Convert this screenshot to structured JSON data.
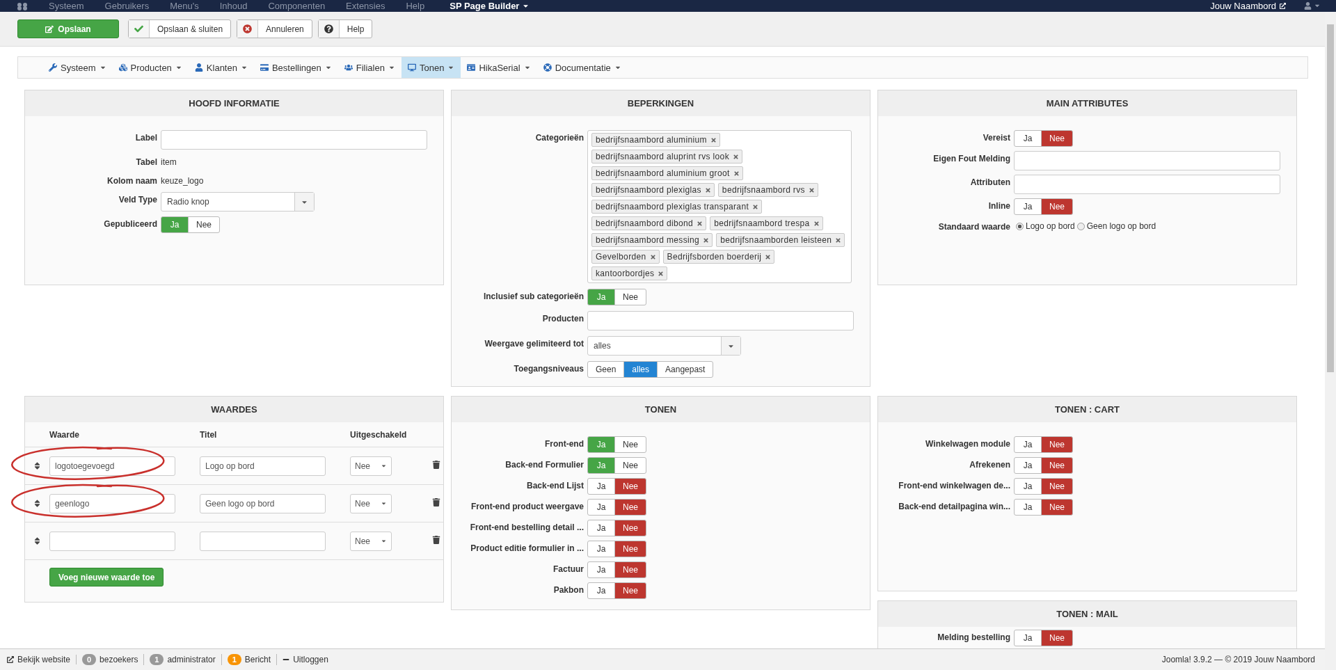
{
  "top_menu": {
    "items": [
      "Systeem",
      "Gebruikers",
      "Menu's",
      "Inhoud",
      "Componenten",
      "Extensies",
      "Help"
    ],
    "app": "SP Page Builder",
    "site": "Jouw Naambord"
  },
  "toolbar": [
    {
      "kind": "primary",
      "label": "Opslaan"
    },
    {
      "kind": "apply",
      "label": "Opslaan & sluiten"
    },
    {
      "kind": "cancel",
      "label": "Annuleren"
    },
    {
      "kind": "help",
      "label": "Help"
    }
  ],
  "nav": [
    {
      "label": "Systeem",
      "selected": false
    },
    {
      "label": "Producten",
      "selected": false
    },
    {
      "label": "Klanten",
      "selected": false
    },
    {
      "label": "Bestellingen",
      "selected": false
    },
    {
      "label": "Filialen",
      "selected": false
    },
    {
      "label": "Tonen",
      "selected": true
    },
    {
      "label": "HikaSerial",
      "selected": false
    },
    {
      "label": "Documentatie",
      "selected": false
    }
  ],
  "panels": [
    {
      "kind": "form",
      "title": "HOOFD INFORMATIE",
      "fields": [
        {
          "kind": "input",
          "label": "Label"
        },
        {
          "kind": "text",
          "label": "Tabel",
          "value": "item"
        },
        {
          "kind": "text",
          "label": "Kolom naam",
          "value": "keuze_logo"
        },
        {
          "kind": "select",
          "label": "Veld Type",
          "value": "Radio knop"
        },
        {
          "kind": "toggle",
          "label": "Gepubliceerd",
          "options": [
            {
              "label": "Ja",
              "selected": true
            },
            {
              "label": "Nee",
              "selected": false
            }
          ]
        }
      ]
    },
    {
      "kind": "form",
      "title": "BEPERKINGEN",
      "fields": [
        {
          "kind": "tags",
          "label": "Categorieën",
          "tags": [
            "bedrijfsnaambord aluminium",
            "bedrijfsnaambord aluprint rvs look",
            "bedrijfsnaambord aluminium groot",
            "bedrijfsnaambord plexiglas",
            "bedrijfsnaambord rvs",
            "bedrijfsnaambord plexiglas transparant",
            "bedrijfsnaambord dibond",
            "bedrijfsnaambord trespa",
            "bedrijfsnaambord messing",
            "bedrijfsnaamborden leisteen",
            "Gevelborden",
            "Bedrijfsborden boerderij",
            "kantoorbordjes"
          ]
        },
        {
          "kind": "toggle",
          "label": "Inclusief sub categorieën",
          "options": [
            {
              "label": "Ja",
              "selected": true
            },
            {
              "label": "Nee",
              "selected": false
            }
          ]
        },
        {
          "kind": "input",
          "label": "Producten"
        },
        {
          "kind": "select",
          "label": "Weergave gelimiteerd tot",
          "value": "alles"
        },
        {
          "kind": "segmented",
          "label": "Toegangsniveaus",
          "options": [
            {
              "label": "Geen",
              "selected": false
            },
            {
              "label": "alles",
              "selected": true
            },
            {
              "label": "Aangepast",
              "selected": false
            }
          ]
        }
      ]
    },
    {
      "kind": "form",
      "title": "MAIN ATTRIBUTES",
      "fields": [
        {
          "kind": "toggle",
          "label": "Vereist",
          "options": [
            {
              "label": "Ja",
              "selected": false
            },
            {
              "label": "Nee",
              "selected": true
            }
          ]
        },
        {
          "kind": "input",
          "label": "Eigen Fout Melding"
        },
        {
          "kind": "input",
          "label": "Attributen"
        },
        {
          "kind": "toggle",
          "label": "Inline",
          "options": [
            {
              "label": "Ja",
              "selected": false
            },
            {
              "label": "Nee",
              "selected": true
            }
          ]
        },
        {
          "kind": "radio",
          "label": "Standaard waarde",
          "options": [
            {
              "label": "Logo op bord",
              "selected": true
            },
            {
              "label": "Geen logo op bord",
              "selected": false
            }
          ]
        }
      ]
    },
    {
      "kind": "values_table",
      "title": "WAARDES",
      "columns": [
        "Waarde",
        "Titel",
        "Uitgeschakeld"
      ],
      "rows": [
        {
          "value": "logotoegevoegd",
          "title": "Logo op bord",
          "disabled": "Nee",
          "circled": true
        },
        {
          "value": "geenlogo",
          "title": "Geen logo op bord",
          "disabled": "Nee",
          "circled": true
        },
        {
          "disabled": "Nee",
          "circled": false
        }
      ],
      "add_button": "Voeg nieuwe waarde toe"
    },
    {
      "kind": "form",
      "title": "TONEN",
      "fields": [
        {
          "kind": "toggle",
          "label": "Front-end",
          "options": [
            {
              "label": "Ja",
              "selected": true
            },
            {
              "label": "Nee",
              "selected": false
            }
          ]
        },
        {
          "kind": "toggle",
          "label": "Back-end Formulier",
          "options": [
            {
              "label": "Ja",
              "selected": true
            },
            {
              "label": "Nee",
              "selected": false
            }
          ]
        },
        {
          "kind": "toggle",
          "label": "Back-end Lijst",
          "options": [
            {
              "label": "Ja",
              "selected": false
            },
            {
              "label": "Nee",
              "selected": true
            }
          ]
        },
        {
          "kind": "toggle",
          "label": "Front-end product weergave",
          "options": [
            {
              "label": "Ja",
              "selected": false
            },
            {
              "label": "Nee",
              "selected": true
            }
          ]
        },
        {
          "kind": "toggle",
          "label": "Front-end bestelling detail ...",
          "options": [
            {
              "label": "Ja",
              "selected": false
            },
            {
              "label": "Nee",
              "selected": true
            }
          ]
        },
        {
          "kind": "toggle",
          "label": "Product editie formulier in ...",
          "options": [
            {
              "label": "Ja",
              "selected": false
            },
            {
              "label": "Nee",
              "selected": true
            }
          ]
        },
        {
          "kind": "toggle",
          "label": "Factuur",
          "options": [
            {
              "label": "Ja",
              "selected": false
            },
            {
              "label": "Nee",
              "selected": true
            }
          ]
        },
        {
          "kind": "toggle",
          "label": "Pakbon",
          "options": [
            {
              "label": "Ja",
              "selected": false
            },
            {
              "label": "Nee",
              "selected": true
            }
          ]
        }
      ]
    },
    {
      "kind": "form",
      "title": "TONEN : CART",
      "fields": [
        {
          "kind": "toggle",
          "label": "Winkelwagen module",
          "options": [
            {
              "label": "Ja",
              "selected": false
            },
            {
              "label": "Nee",
              "selected": true
            }
          ]
        },
        {
          "kind": "toggle",
          "label": "Afrekenen",
          "options": [
            {
              "label": "Ja",
              "selected": false
            },
            {
              "label": "Nee",
              "selected": true
            }
          ]
        },
        {
          "kind": "toggle",
          "label": "Front-end winkelwagen de...",
          "options": [
            {
              "label": "Ja",
              "selected": false
            },
            {
              "label": "Nee",
              "selected": true
            }
          ]
        },
        {
          "kind": "toggle",
          "label": "Back-end detailpagina win...",
          "options": [
            {
              "label": "Ja",
              "selected": false
            },
            {
              "label": "Nee",
              "selected": true
            }
          ]
        }
      ]
    },
    {
      "kind": "form",
      "title": "TONEN : MAIL",
      "fields": [
        {
          "kind": "toggle",
          "label": "Melding bestelling",
          "options": [
            {
              "label": "Ja",
              "selected": false
            },
            {
              "label": "Nee",
              "selected": true
            }
          ]
        }
      ]
    }
  ],
  "status_bar": {
    "items": [
      {
        "kind": "link",
        "label": "Bekijk website"
      },
      {
        "kind": "badge",
        "count": "0",
        "label": "bezoekers",
        "color": "#999999"
      },
      {
        "kind": "badge",
        "count": "1",
        "label": "administrator",
        "color": "#999999"
      },
      {
        "kind": "badge",
        "count": "1",
        "label": "Bericht",
        "color": "#f89406"
      },
      {
        "kind": "logout",
        "label": "Uitloggen"
      }
    ],
    "right": "Joomla! 3.9.2 — © 2019 Jouw Naambord"
  }
}
